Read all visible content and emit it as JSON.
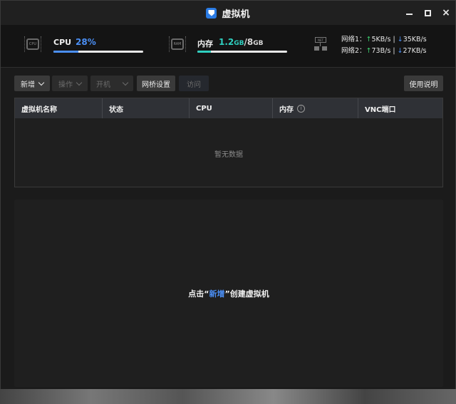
{
  "window": {
    "title": "虚拟机"
  },
  "stats": {
    "cpu": {
      "label": "CPU",
      "value": "28%",
      "percent": 28,
      "color": "#4b8ff5"
    },
    "mem": {
      "label": "内存",
      "used": "1.2",
      "used_unit": "GB",
      "sep": "/",
      "total": "8",
      "total_unit": "GB",
      "percent": 15,
      "color": "#2fd0c0"
    },
    "net": {
      "rows": [
        {
          "label": "网络1：",
          "up_arrow": "↑",
          "up": "5KB/s",
          "sep": "|",
          "down_arrow": "↓",
          "down": "35KB/s"
        },
        {
          "label": "网络2：",
          "up_arrow": "↑",
          "up": "73B/s",
          "sep": "|",
          "down_arrow": "↓",
          "down": "27KB/s"
        }
      ]
    },
    "icons": {
      "cpu": "cpu-chip-icon",
      "ram": "ram-chip-icon",
      "net": "network-icon"
    },
    "chip_labels": {
      "cpu": "CPU",
      "ram": "RAM",
      "net": "NET"
    }
  },
  "toolbar": {
    "add": "新增",
    "operate": "操作",
    "power": "开机",
    "bridge": "网桥设置",
    "visit": "访问",
    "help": "使用说明"
  },
  "table": {
    "columns": [
      "虚拟机名称",
      "状态",
      "CPU",
      "内存",
      "VNC端口"
    ],
    "empty": "暂无数据"
  },
  "hint": {
    "prefix": "点击",
    "open_quote": "“",
    "link": "新增",
    "close_quote": "”",
    "suffix": "创建虚拟机"
  }
}
